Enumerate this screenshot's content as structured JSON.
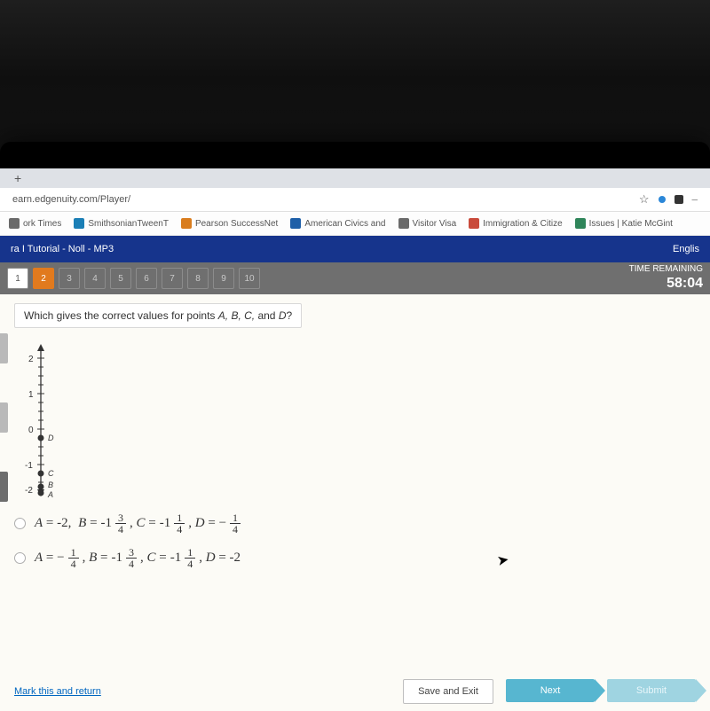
{
  "browser": {
    "url": "earn.edgenuity.com/Player/",
    "bookmarks": [
      {
        "label": "ork Times",
        "cls": "g"
      },
      {
        "label": "SmithsonianTweenT",
        "cls": "t"
      },
      {
        "label": "Pearson SuccessNet",
        "cls": "o"
      },
      {
        "label": "American Civics and",
        "cls": "b"
      },
      {
        "label": "Visitor Visa",
        "cls": "g"
      },
      {
        "label": "Immigration & Citize",
        "cls": "r"
      },
      {
        "label": "Issues | Katie McGint",
        "cls": "gr"
      }
    ]
  },
  "header": {
    "course_title": "ra I Tutorial - Noll - MP3",
    "lang": "Englis"
  },
  "timer": {
    "label": "TIME REMAINING",
    "value": "58:04"
  },
  "questions": {
    "numbers": [
      "1",
      "2",
      "3",
      "4",
      "5",
      "6",
      "7",
      "8",
      "9",
      "10"
    ],
    "done_index": 0,
    "active_index": 1
  },
  "question_text": {
    "prefix": "Which gives the correct values for points ",
    "letters": "A, B, C,",
    "and": " and ",
    "last": "D",
    "suffix": "?"
  },
  "numberline": {
    "ticks": [
      "2",
      "1",
      "0",
      "-1",
      "-2"
    ],
    "points": [
      "D",
      "C",
      "B",
      "A"
    ]
  },
  "options": {
    "a": {
      "A_whole": "-2",
      "B_whole": "-1",
      "B_num": "3",
      "B_den": "4",
      "C_whole": "-1",
      "C_num": "1",
      "C_den": "4",
      "D_num": "1",
      "D_den": "4"
    },
    "b": {
      "A_num": "1",
      "A_den": "4",
      "B_whole": "-1",
      "B_num": "3",
      "B_den": "4",
      "C_whole": "-1",
      "C_num": "1",
      "C_den": "4",
      "D_whole": "-2"
    }
  },
  "footer": {
    "link": "Mark this and return",
    "save": "Save and Exit",
    "next": "Next",
    "submit": "Submit"
  }
}
